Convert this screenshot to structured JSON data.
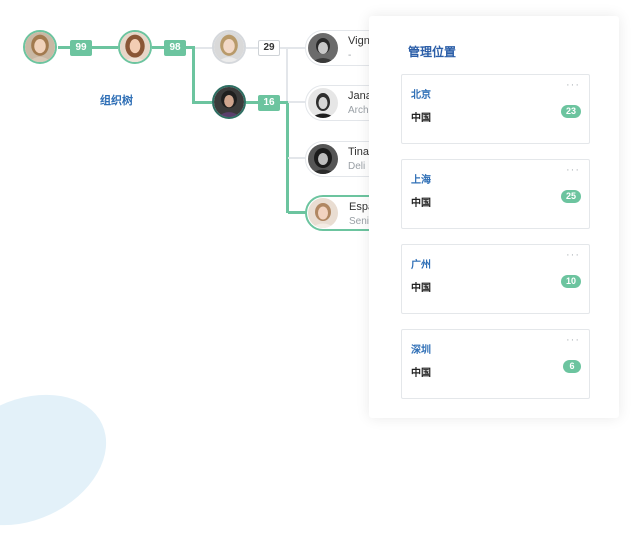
{
  "tree": {
    "label": "组织树",
    "badges": [
      "99",
      "98",
      "29",
      "16"
    ],
    "members": [
      {
        "name": "Vign",
        "role": "-"
      },
      {
        "name": "Jana",
        "role": "Arch"
      },
      {
        "name": "Tina",
        "role": "Deli"
      },
      {
        "name": "Espa",
        "role": "Seni"
      }
    ]
  },
  "panel": {
    "title": "管理位置",
    "locations": [
      {
        "city": "北京",
        "country": "中国",
        "count": "23",
        "more": "···"
      },
      {
        "city": "上海",
        "country": "中国",
        "count": "25",
        "more": "···"
      },
      {
        "city": "广州",
        "country": "中国",
        "count": "10",
        "more": "···"
      },
      {
        "city": "深圳",
        "country": "中国",
        "count": "6",
        "more": "···"
      }
    ]
  },
  "colors": {
    "accent": "#6cc49f",
    "title": "#2b5ea8",
    "link": "#2f6fb6"
  }
}
